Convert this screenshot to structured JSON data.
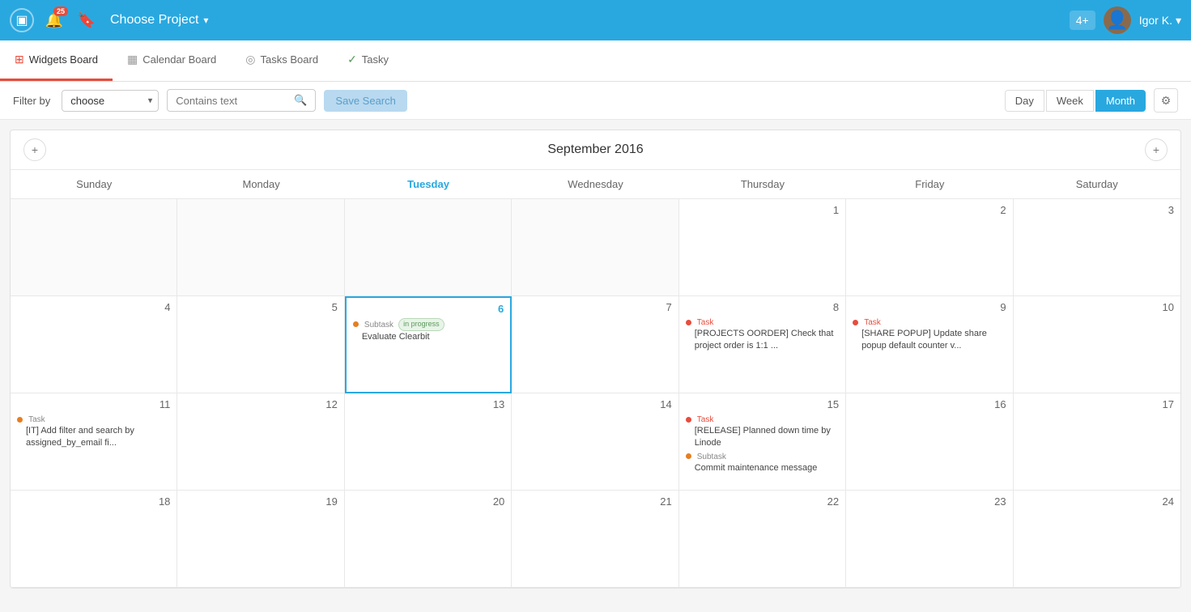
{
  "header": {
    "project_label": "Choose Project",
    "notification_count": "25",
    "plus_label": "4+",
    "username": "Igor K.",
    "username_arrow": "▾"
  },
  "tabs": [
    {
      "id": "widgets",
      "label": "Widgets Board",
      "icon": "⊞",
      "active": true
    },
    {
      "id": "calendar",
      "label": "Calendar Board",
      "icon": "▦",
      "active": false
    },
    {
      "id": "tasks",
      "label": "Tasks Board",
      "icon": "◎",
      "active": false
    },
    {
      "id": "tasky",
      "label": "Tasky",
      "icon": "✓",
      "active": false
    }
  ],
  "toolbar": {
    "filter_label": "Filter by",
    "filter_value": "choose",
    "filter_placeholder": "choose",
    "search_placeholder": "Contains text",
    "save_search_label": "Save Search",
    "view_buttons": [
      "Day",
      "Week",
      "Month"
    ],
    "active_view": "Month",
    "settings_icon": "⚙"
  },
  "calendar": {
    "title": "September 2016",
    "day_headers": [
      "Sunday",
      "Monday",
      "Tuesday",
      "Wednesday",
      "Thursday",
      "Friday",
      "Saturday"
    ],
    "today_header_index": 2,
    "weeks": [
      [
        {
          "date": "",
          "empty": true
        },
        {
          "date": "",
          "empty": true
        },
        {
          "date": "",
          "empty": true
        },
        {
          "date": "",
          "empty": true
        },
        {
          "date": "1"
        },
        {
          "date": "2"
        },
        {
          "date": "3"
        }
      ],
      [
        {
          "date": "4"
        },
        {
          "date": "5"
        },
        {
          "date": "6",
          "today": true,
          "events": [
            {
              "type": "Subtask",
              "badge": "in progress",
              "text": "Evaluate Clearbit",
              "dot": "orange"
            }
          ]
        },
        {
          "date": "7"
        },
        {
          "date": "8",
          "events": [
            {
              "type": "Task",
              "text": "[PROJECTS OORDER] Check that project order is 1:1 ...",
              "dot": "red"
            }
          ]
        },
        {
          "date": "9",
          "events": [
            {
              "type": "Task",
              "text": "[SHARE POPUP] Update share popup default counter v...",
              "dot": "red"
            }
          ]
        },
        {
          "date": "10"
        }
      ],
      [
        {
          "date": "11",
          "events": [
            {
              "type": "Task",
              "text": "[IT] Add filter and search by assigned_by_email fi...",
              "dot": "orange"
            }
          ]
        },
        {
          "date": "12"
        },
        {
          "date": "13"
        },
        {
          "date": "14"
        },
        {
          "date": "15",
          "events": [
            {
              "type": "Task",
              "text": "[RELEASE] Planned down time by Linode",
              "dot": "red"
            },
            {
              "type": "Subtask",
              "text": "Commit maintenance message",
              "dot": "orange"
            }
          ]
        },
        {
          "date": "16"
        },
        {
          "date": "17"
        }
      ],
      [
        {
          "date": "18"
        },
        {
          "date": "19"
        },
        {
          "date": "20"
        },
        {
          "date": "21"
        },
        {
          "date": "22"
        },
        {
          "date": "23"
        },
        {
          "date": "24"
        }
      ]
    ]
  }
}
